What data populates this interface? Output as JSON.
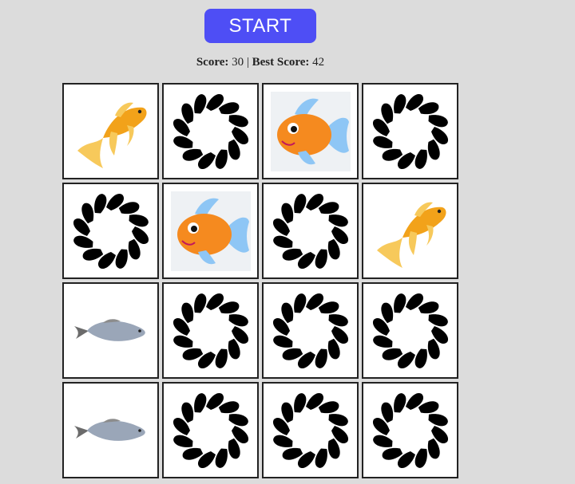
{
  "start_button": {
    "label": "START"
  },
  "score": {
    "score_label": "Score:",
    "score_value": "30",
    "separator": "|",
    "best_label": "Best Score:",
    "best_value": "42"
  },
  "board": {
    "cards": [
      {
        "state": "revealed",
        "image": "goldfish"
      },
      {
        "state": "hidden",
        "image": "card-back"
      },
      {
        "state": "revealed",
        "image": "cartoon-fish"
      },
      {
        "state": "hidden",
        "image": "card-back"
      },
      {
        "state": "hidden",
        "image": "card-back"
      },
      {
        "state": "revealed",
        "image": "cartoon-fish"
      },
      {
        "state": "hidden",
        "image": "card-back"
      },
      {
        "state": "revealed",
        "image": "goldfish"
      },
      {
        "state": "revealed",
        "image": "silver-fish"
      },
      {
        "state": "hidden",
        "image": "card-back"
      },
      {
        "state": "hidden",
        "image": "card-back"
      },
      {
        "state": "hidden",
        "image": "card-back"
      },
      {
        "state": "revealed",
        "image": "silver-fish"
      },
      {
        "state": "hidden",
        "image": "card-back"
      },
      {
        "state": "hidden",
        "image": "card-back"
      },
      {
        "state": "hidden",
        "image": "card-back"
      }
    ]
  },
  "colors": {
    "background": "#dcdcdc",
    "start_button": "#4e4ef5",
    "card_border": "#222222",
    "card_back_pattern": "#000000",
    "goldfish": "#f2a21a",
    "cartoon_fish_body": "#f58a1f",
    "cartoon_fish_fin": "#8ec6f5",
    "silver_fish": "#9aa6b8"
  }
}
